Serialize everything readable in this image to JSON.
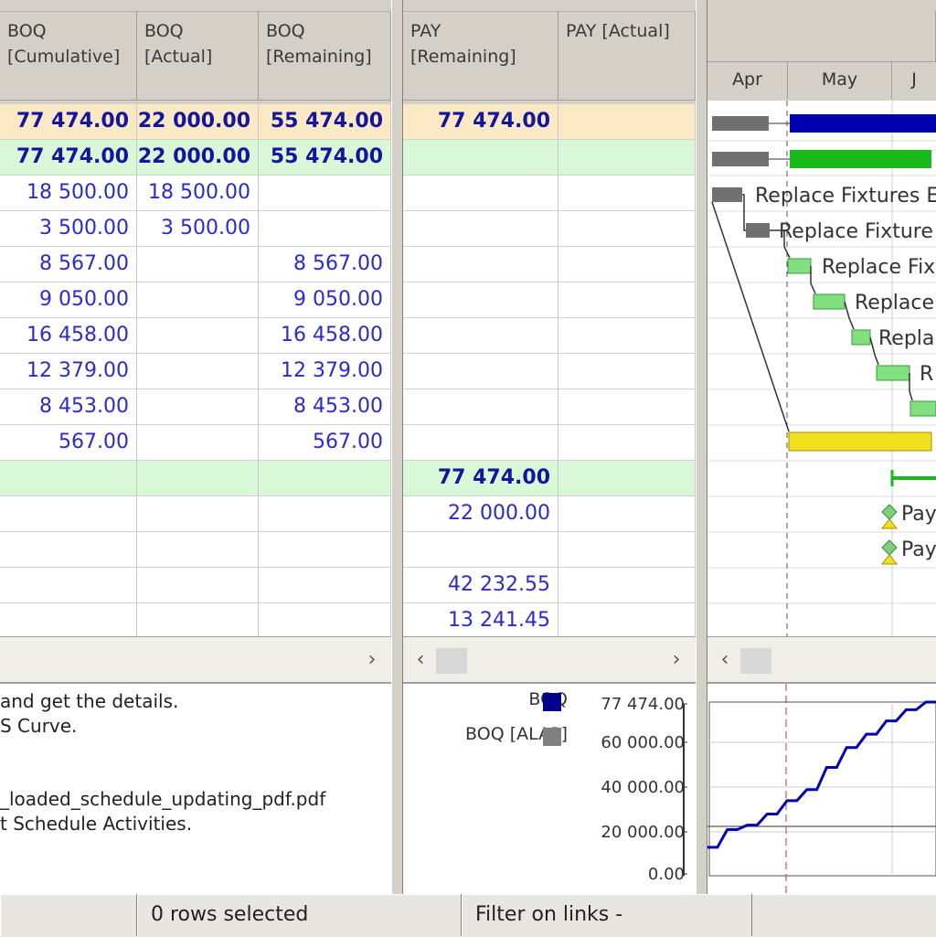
{
  "headers": {
    "boq_cumulative": "BOQ\n[Cumulative]",
    "boq_actual": "BOQ\n[Actual]",
    "boq_remaining": "BOQ\n[Remaining]",
    "pay_remaining": "PAY\n[Remaining]",
    "pay_actual": "PAY [Actual]"
  },
  "rows": [
    {
      "cum": "77 474.00",
      "act": "22 000.00",
      "rem": "55 474.00",
      "pay_rem": "77 474.00",
      "pay_act": "",
      "style": "summary-orange"
    },
    {
      "cum": "77 474.00",
      "act": "22 000.00",
      "rem": "55 474.00",
      "pay_rem": "",
      "pay_act": "",
      "style": "summary-green"
    },
    {
      "cum": "18 500.00",
      "act": "18 500.00",
      "rem": "",
      "pay_rem": "",
      "pay_act": "",
      "style": "normal"
    },
    {
      "cum": "3 500.00",
      "act": "3 500.00",
      "rem": "",
      "pay_rem": "",
      "pay_act": "",
      "style": "normal"
    },
    {
      "cum": "8 567.00",
      "act": "",
      "rem": "8 567.00",
      "pay_rem": "",
      "pay_act": "",
      "style": "normal"
    },
    {
      "cum": "9 050.00",
      "act": "",
      "rem": "9 050.00",
      "pay_rem": "",
      "pay_act": "",
      "style": "normal"
    },
    {
      "cum": "16 458.00",
      "act": "",
      "rem": "16 458.00",
      "pay_rem": "",
      "pay_act": "",
      "style": "normal"
    },
    {
      "cum": "12 379.00",
      "act": "",
      "rem": "12 379.00",
      "pay_rem": "",
      "pay_act": "",
      "style": "normal"
    },
    {
      "cum": "8 453.00",
      "act": "",
      "rem": "8 453.00",
      "pay_rem": "",
      "pay_act": "",
      "style": "normal"
    },
    {
      "cum": "567.00",
      "act": "",
      "rem": "567.00",
      "pay_rem": "",
      "pay_act": "",
      "style": "normal"
    },
    {
      "cum": "",
      "act": "",
      "rem": "",
      "pay_rem": "77 474.00",
      "pay_act": "",
      "style": "summary-green"
    },
    {
      "cum": "",
      "act": "",
      "rem": "",
      "pay_rem": "22 000.00",
      "pay_act": "",
      "style": "normal"
    },
    {
      "cum": "",
      "act": "",
      "rem": "",
      "pay_rem": "",
      "pay_act": "",
      "style": "normal"
    },
    {
      "cum": "",
      "act": "",
      "rem": "",
      "pay_rem": "42 232.55",
      "pay_act": "",
      "style": "normal"
    },
    {
      "cum": "",
      "act": "",
      "rem": "",
      "pay_rem": "13 241.45",
      "pay_act": "",
      "style": "normal"
    }
  ],
  "gantt": {
    "months": [
      "Apr",
      "May",
      "J"
    ],
    "labels": [
      "Replace Fixtures E",
      "Replace Fixture",
      "Replace Fix",
      "Replace",
      "Repla",
      "R"
    ],
    "milestones": [
      "Pay",
      "Pay"
    ]
  },
  "notes": [
    "and get the details.",
    "S Curve.",
    "",
    "_loaded_schedule_updating_pdf.pdf",
    "t Schedule Activities."
  ],
  "legend": [
    {
      "label": "BOQ",
      "color": "#00008b"
    },
    {
      "label": "BOQ [ALAP]",
      "color": "#808080"
    }
  ],
  "chart_data": {
    "type": "line",
    "yticks": [
      "77 474.00",
      "60 000.00",
      "40 000.00",
      "20 000.00",
      "0.00"
    ],
    "ylim": [
      0,
      77474
    ],
    "series": [
      {
        "name": "BOQ",
        "values": [
          12000,
          12000,
          20000,
          20000,
          22000,
          22000,
          27000,
          27000,
          33000,
          33000,
          38000,
          38000,
          48000,
          48000,
          57000,
          57000,
          63000,
          63000,
          69000,
          69000,
          74000,
          74000,
          77474,
          77474
        ]
      }
    ]
  },
  "status": {
    "rows_selected": "0 rows selected",
    "filter": "Filter on links -"
  }
}
